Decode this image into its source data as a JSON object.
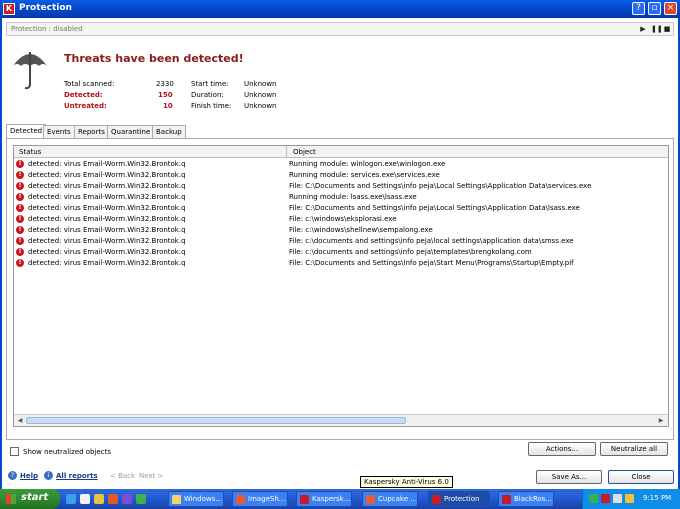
{
  "window": {
    "title": "Protection",
    "status_strip": "Protection : disabled",
    "app_icon_letter": "K"
  },
  "headline": "Threats have been detected!",
  "stats": {
    "total_scanned_label": "Total scanned:",
    "total_scanned_value": "2330",
    "detected_label": "Detected:",
    "detected_value": "150",
    "untreated_label": "Untreated:",
    "untreated_value": "10",
    "start_time_label": "Start time:",
    "start_time_value": "Unknown",
    "duration_label": "Duration:",
    "duration_value": "Unknown",
    "finish_time_label": "Finish time:",
    "finish_time_value": "Unknown"
  },
  "tabs": [
    "Detected",
    "Events",
    "Reports",
    "Quarantine",
    "Backup"
  ],
  "grid": {
    "columns": [
      "Status",
      "Object"
    ],
    "rows": [
      {
        "status": "detected: virus Email-Worm.Win32.Brontok.q",
        "object": "Running module: winlogon.exe\\winlogon.exe"
      },
      {
        "status": "detected: virus Email-Worm.Win32.Brontok.q",
        "object": "Running module: services.exe\\services.exe"
      },
      {
        "status": "detected: virus Email-Worm.Win32.Brontok.q",
        "object": "File: C:\\Documents and Settings\\info peja\\Local Settings\\Application Data\\services.exe"
      },
      {
        "status": "detected: virus Email-Worm.Win32.Brontok.q",
        "object": "Running module: lsass.exe\\lsass.exe"
      },
      {
        "status": "detected: virus Email-Worm.Win32.Brontok.q",
        "object": "File: C:\\Documents and Settings\\info peja\\Local Settings\\Application Data\\lsass.exe"
      },
      {
        "status": "detected: virus Email-Worm.Win32.Brontok.q",
        "object": "File: c:\\windows\\eksplorasi.exe"
      },
      {
        "status": "detected: virus Email-Worm.Win32.Brontok.q",
        "object": "File: c:\\windows\\shellnew\\sempalong.exe"
      },
      {
        "status": "detected: virus Email-Worm.Win32.Brontok.q",
        "object": "File: c:\\documents and settings\\info peja\\local settings\\application data\\smss.exe"
      },
      {
        "status": "detected: virus Email-Worm.Win32.Brontok.q",
        "object": "File: c:\\documents and settings\\info peja\\templates\\brengkolang.com"
      },
      {
        "status": "detected: virus Email-Worm.Win32.Brontok.q",
        "object": "File: C:\\Documents and Settings\\info peja\\Start Menu\\Programs\\Startup\\Empty.pif"
      }
    ]
  },
  "show_neutralized_label": "Show neutralized objects",
  "buttons": {
    "actions": "Actions...",
    "neutralize_all": "Neutralize all",
    "save_as": "Save As...",
    "close": "Close"
  },
  "footer": {
    "help": "Help",
    "all_reports": "All reports",
    "back": "< Back",
    "next": "Next >"
  },
  "tooltip": "Kaspersky Anti-Virus 6.0",
  "taskbar": {
    "start": "start",
    "tasks": [
      "Windows...",
      "ImageSh...",
      "Kaspersk...",
      "Cupcake ...",
      "Protection",
      "BlackRos..."
    ],
    "clock": "9:15 PM"
  },
  "colors": {
    "title_bar": "#0447c9",
    "headline": "#8b1a1a",
    "alert_red": "#c8171f",
    "taskbar": "#245edb",
    "start_green": "#2f8a2f"
  }
}
